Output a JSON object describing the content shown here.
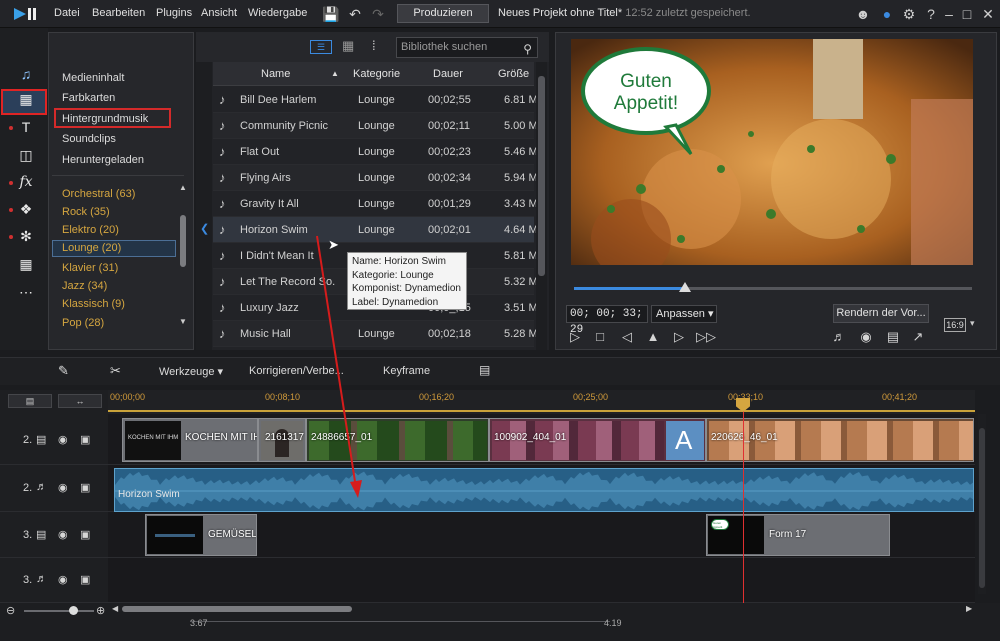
{
  "menu": [
    "Datei",
    "Bearbeiten",
    "Plugins",
    "Ansicht",
    "Wiedergabe"
  ],
  "produce_label": "Produzieren",
  "project": {
    "title": "Neues Projekt ohne Titel*",
    "saved": "12:52 zuletzt gespeichert."
  },
  "categories": [
    "Medieninhalt",
    "Farbkarten",
    "Hintergrundmusik",
    "Soundclips",
    "Heruntergeladen"
  ],
  "genres": [
    "Orchestral  (63)",
    "Rock  (35)",
    "Elektro  (20)",
    "Lounge  (20)",
    "Klavier  (31)",
    "Jazz  (34)",
    "Klassisch  (9)",
    "Pop  (28)"
  ],
  "search_placeholder": "Bibliothek suchen",
  "library": {
    "headers": {
      "name": "Name",
      "category": "Kategorie",
      "duration": "Dauer",
      "size": "Größe"
    },
    "rows": [
      {
        "name": "Bill Dee Harlem",
        "category": "Lounge",
        "duration": "00;02;55",
        "size": "6.81 M"
      },
      {
        "name": "Community Picnic",
        "category": "Lounge",
        "duration": "00;02;11",
        "size": "5.00 M"
      },
      {
        "name": "Flat Out",
        "category": "Lounge",
        "duration": "00;02;23",
        "size": "5.46 M"
      },
      {
        "name": "Flying Airs",
        "category": "Lounge",
        "duration": "00;02;34",
        "size": "5.94 M"
      },
      {
        "name": "Gravity It All",
        "category": "Lounge",
        "duration": "00;01;29",
        "size": "3.43 M"
      },
      {
        "name": "Horizon Swim",
        "category": "Lounge",
        "duration": "00;02;01",
        "size": "4.64 M"
      },
      {
        "name": "I Didn't Mean It",
        "category": "",
        "duration": "",
        "size": "5.81 M"
      },
      {
        "name": "Let The Record So...",
        "category": "",
        "duration": "",
        "size": "5.32 M"
      },
      {
        "name": "Luxury Jazz",
        "category": "",
        "duration": "00;0_;15",
        "size": "3.51 M"
      },
      {
        "name": "Music Hall",
        "category": "Lounge",
        "duration": "00;02;18",
        "size": "5.28 M"
      }
    ]
  },
  "tooltip": [
    "Name: Horizon Swim",
    "Kategorie: Lounge",
    "Komponist: Dynamedion",
    "Label: Dynamedion"
  ],
  "preview": {
    "bubble_text": "Guten\nAppetit!",
    "timecode": "00; 00; 33; 29",
    "fit": "Anpassen",
    "render": "Rendern der Vor...",
    "ratio": "16:9",
    "progress": 0.28
  },
  "timeline_tools": {
    "tools": "Werkzeuge",
    "fix": "Korrigieren/Verbe...",
    "keyframe": "Keyframe"
  },
  "ruler": [
    "00;00;00",
    "00;08;10",
    "00;16;20",
    "00;25;00",
    "00;33;10",
    "00;41;20"
  ],
  "tracks": [
    {
      "num": "2.",
      "type": "video"
    },
    {
      "num": "2.",
      "type": "audio"
    },
    {
      "num": "3.",
      "type": "video"
    },
    {
      "num": "3.",
      "type": "audio"
    }
  ],
  "clips": {
    "video2": [
      "KOCHEN MIT IHM",
      "2161317",
      "24886657_01",
      "100902_404_01",
      "220626_46_01"
    ],
    "audio": "Horizon Swim",
    "video3": [
      "GEMÜSELA",
      "Form 17"
    ],
    "thumb_small_text": "KOCHEN MIT IHM",
    "form_thumb_text": "Guten Appetit"
  },
  "bottom": {
    "left": "3.67",
    "right": "4.19"
  },
  "colors": {
    "accent": "#3b8ae0",
    "red": "#e02424",
    "genre": "#d5a640"
  }
}
